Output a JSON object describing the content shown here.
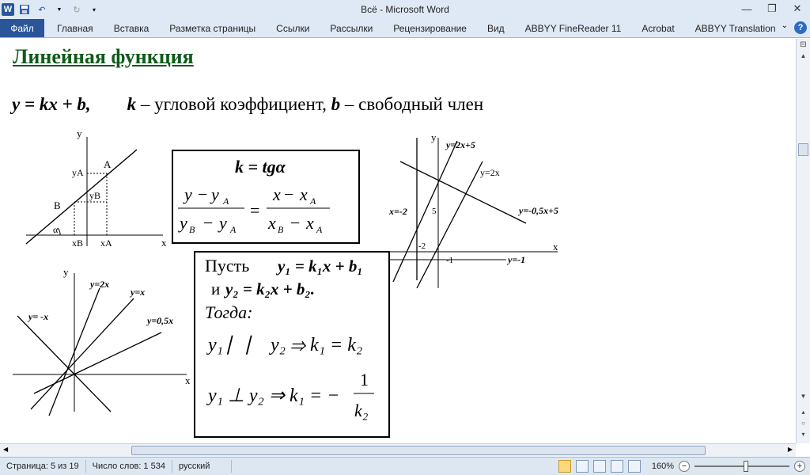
{
  "window": {
    "title": "Всё  -  Microsoft Word",
    "controls": {
      "minimize": "—",
      "restore": "❐",
      "close": "✕"
    }
  },
  "ribbon": {
    "tabs": [
      "Файл",
      "Главная",
      "Вставка",
      "Разметка страницы",
      "Ссылки",
      "Рассылки",
      "Рецензирование",
      "Вид",
      "ABBYY FineReader 11",
      "Acrobat",
      "ABBYY Translation"
    ]
  },
  "document": {
    "heading": "Линейная функция",
    "line1": {
      "formula": "y = kx + b,",
      "k": "k",
      "k_desc": " – угловой коэффициент, ",
      "b": "b",
      "b_desc": " – свободный член"
    },
    "graph1": {
      "axis_x": "x",
      "axis_y": "y",
      "yA": "yA",
      "yB": "yB",
      "xB": "xB",
      "xA": "xA",
      "A": "A",
      "B": "B",
      "alpha": "α"
    },
    "box1": {
      "k_tg": "k = tgα",
      "y": "y",
      "yA": "y",
      "x": "x",
      "xA": "x",
      "sub_A": "A",
      "sub_B": "B"
    },
    "graph2": {
      "axis_x": "x",
      "axis_y": "y",
      "l1": "y=2x+5",
      "l2": "y=2x",
      "l3": "y=-0,5x+5",
      "l4": "x=-2",
      "l5": "y=-1",
      "t5": "5",
      "tm2": "-2",
      "tm1": "-1"
    },
    "graph3": {
      "axis_x": "x",
      "axis_y": "y",
      "l1": "y=2x",
      "l2": "y=x",
      "l3": "y=0,5x",
      "l4": "y= -x"
    },
    "box2": {
      "let": "Пусть",
      "eq1": "y₁ = k₁x + b₁",
      "and": "и",
      "eq2": "y₂ = k₂x + b₂.",
      "then": "Тогда:",
      "parallel": "y₁ ⎸⎸ y₂ ⇒ k₁ = k₂",
      "perp": "y₁ ⊥ y₂ ⇒ k₁ = −",
      "one": "1",
      "k2": "k₂"
    }
  },
  "statusbar": {
    "page": "Страница: 5 из 19",
    "words": "Число слов: 1 534",
    "language": "русский",
    "zoom": "160%"
  }
}
